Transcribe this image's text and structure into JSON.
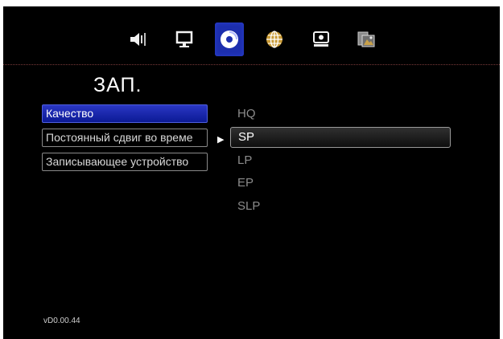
{
  "tabs": [
    {
      "icon": "speaker-icon"
    },
    {
      "icon": "monitor-icon"
    },
    {
      "icon": "disc-icon",
      "active": true
    },
    {
      "icon": "globe-icon"
    },
    {
      "icon": "system-icon"
    },
    {
      "icon": "photo-icon"
    }
  ],
  "page": {
    "title": "ЗАП."
  },
  "menu": {
    "items": [
      {
        "label": "Качество",
        "selected": true
      },
      {
        "label": "Постоянный сдвиг во време"
      },
      {
        "label": "Записывающее устройство"
      }
    ]
  },
  "options": {
    "items": [
      "HQ",
      "SP",
      "LP",
      "EP",
      "SLP"
    ],
    "current": "SP"
  },
  "footer": {
    "version": "vD0.00.44"
  },
  "colors": {
    "accent": "#1d2fae",
    "background": "#000000"
  }
}
